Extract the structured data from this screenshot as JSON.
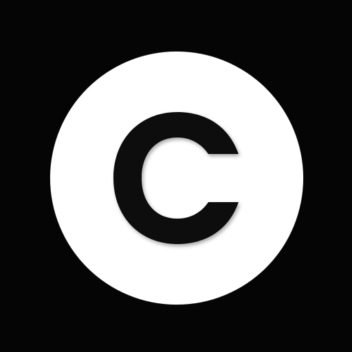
{
  "icon": {
    "name": "copyright-icon",
    "background_color": "#050505",
    "disc_color": "#ffffff",
    "glyph_color": "#111111"
  }
}
